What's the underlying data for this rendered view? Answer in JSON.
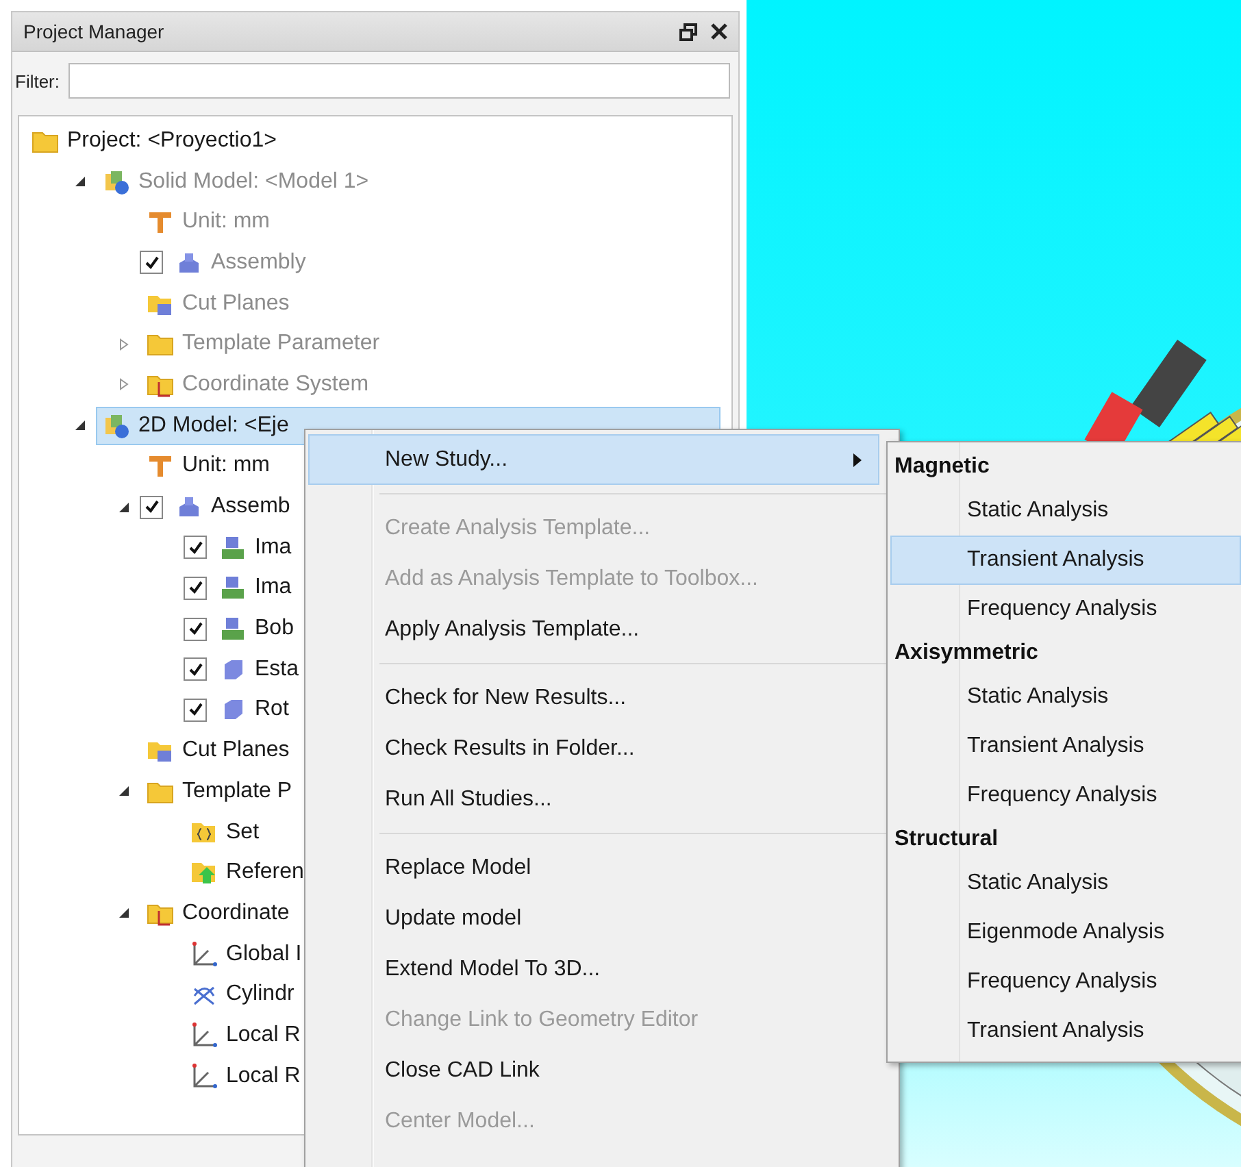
{
  "panel": {
    "title": "Project Manager",
    "filter": {
      "label": "Filter:"
    },
    "tree": [
      {
        "label": "Project: <Proyectio1>",
        "kind": "folder",
        "disabled": false,
        "selected": false,
        "children": [
          {
            "label": "Solid Model: <Model 1>",
            "kind": "model",
            "disabled": true,
            "selected": false,
            "expanded": true,
            "children": [
              {
                "label": "Unit: mm",
                "kind": "unit",
                "disabled": true,
                "selected": false
              },
              {
                "label": "Assembly",
                "kind": "assembly",
                "disabled": true,
                "selected": false,
                "checked": true
              },
              {
                "label": "Cut Planes",
                "kind": "cut-planes",
                "disabled": true,
                "selected": false
              },
              {
                "label": "Template Parameter",
                "kind": "folder",
                "disabled": true,
                "selected": false,
                "expanded": false
              },
              {
                "label": "Coordinate System",
                "kind": "coord-folder",
                "disabled": true,
                "selected": false,
                "expanded": false
              }
            ]
          },
          {
            "label": "2D Model: <Eje",
            "kind": "model",
            "disabled": false,
            "selected": true,
            "expanded": true,
            "children": [
              {
                "label": "Unit: mm",
                "kind": "unit",
                "disabled": false,
                "selected": false
              },
              {
                "label": "Assemb",
                "kind": "assembly",
                "disabled": false,
                "selected": false,
                "checked": true,
                "expanded": true,
                "children": [
                  {
                    "label": "Ima",
                    "kind": "part-green",
                    "disabled": false,
                    "selected": false,
                    "checked": true
                  },
                  {
                    "label": "Ima",
                    "kind": "part-green",
                    "disabled": false,
                    "selected": false,
                    "checked": true
                  },
                  {
                    "label": "Bob",
                    "kind": "part-green",
                    "disabled": false,
                    "selected": false,
                    "checked": true
                  },
                  {
                    "label": "Esta",
                    "kind": "part-blue",
                    "disabled": false,
                    "selected": false,
                    "checked": true
                  },
                  {
                    "label": "Rot",
                    "kind": "part-blue",
                    "disabled": false,
                    "selected": false,
                    "checked": true
                  }
                ]
              },
              {
                "label": "Cut Planes",
                "kind": "cut-planes",
                "disabled": false,
                "selected": false
              },
              {
                "label": "Template P",
                "kind": "folder",
                "disabled": false,
                "selected": false,
                "expanded": true,
                "children": [
                  {
                    "label": "Set",
                    "kind": "set",
                    "disabled": false,
                    "selected": false
                  },
                  {
                    "label": "Referen",
                    "kind": "reference",
                    "disabled": false,
                    "selected": false
                  }
                ]
              },
              {
                "label": "Coordinate",
                "kind": "coord-folder",
                "disabled": false,
                "selected": false,
                "expanded": true,
                "children": [
                  {
                    "label": "Global I",
                    "kind": "axes",
                    "disabled": false,
                    "selected": false
                  },
                  {
                    "label": "Cylindr",
                    "kind": "cylindrical",
                    "disabled": false,
                    "selected": false
                  },
                  {
                    "label": "Local R",
                    "kind": "axes",
                    "disabled": false,
                    "selected": false
                  },
                  {
                    "label": "Local R",
                    "kind": "axes",
                    "disabled": false,
                    "selected": false
                  }
                ]
              }
            ]
          }
        ]
      }
    ]
  },
  "context_menu": {
    "groups": [
      [
        {
          "label": "New Study...",
          "disabled": false,
          "selected": true,
          "has_submenu": true
        }
      ],
      [
        {
          "label": "Create Analysis Template...",
          "disabled": true,
          "selected": false,
          "has_submenu": false
        },
        {
          "label": "Add as Analysis Template to Toolbox...",
          "disabled": true,
          "selected": false,
          "has_submenu": false
        },
        {
          "label": "Apply Analysis Template...",
          "disabled": false,
          "selected": false,
          "has_submenu": false
        }
      ],
      [
        {
          "label": "Check for New Results...",
          "disabled": false,
          "selected": false,
          "has_submenu": false
        },
        {
          "label": "Check Results in Folder...",
          "disabled": false,
          "selected": false,
          "has_submenu": false
        },
        {
          "label": "Run All Studies...",
          "disabled": false,
          "selected": false,
          "has_submenu": false
        }
      ],
      [
        {
          "label": "Replace Model",
          "disabled": false,
          "selected": false,
          "has_submenu": false
        },
        {
          "label": "Update model",
          "disabled": false,
          "selected": false,
          "has_submenu": false
        },
        {
          "label": "Extend Model To 3D...",
          "disabled": false,
          "selected": false,
          "has_submenu": false
        },
        {
          "label": "Change Link to Geometry Editor",
          "disabled": true,
          "selected": false,
          "has_submenu": false
        },
        {
          "label": "Close CAD Link",
          "disabled": false,
          "selected": false,
          "has_submenu": false
        },
        {
          "label": "Center Model...",
          "disabled": true,
          "selected": false,
          "has_submenu": false
        }
      ]
    ]
  },
  "submenu": {
    "sections": [
      {
        "heading": "Magnetic",
        "items": [
          {
            "label": "Static Analysis",
            "selected": false
          },
          {
            "label": "Transient Analysis",
            "selected": true
          },
          {
            "label": "Frequency Analysis",
            "selected": false
          }
        ]
      },
      {
        "heading": "Axisymmetric",
        "items": [
          {
            "label": "Static Analysis",
            "selected": false
          },
          {
            "label": "Transient Analysis",
            "selected": false
          },
          {
            "label": "Frequency Analysis",
            "selected": false
          }
        ]
      },
      {
        "heading": "Structural",
        "items": [
          {
            "label": "Static Analysis",
            "selected": false
          },
          {
            "label": "Eigenmode Analysis",
            "selected": false
          },
          {
            "label": "Frequency Analysis",
            "selected": false
          },
          {
            "label": "Transient Analysis",
            "selected": false
          }
        ]
      }
    ]
  }
}
